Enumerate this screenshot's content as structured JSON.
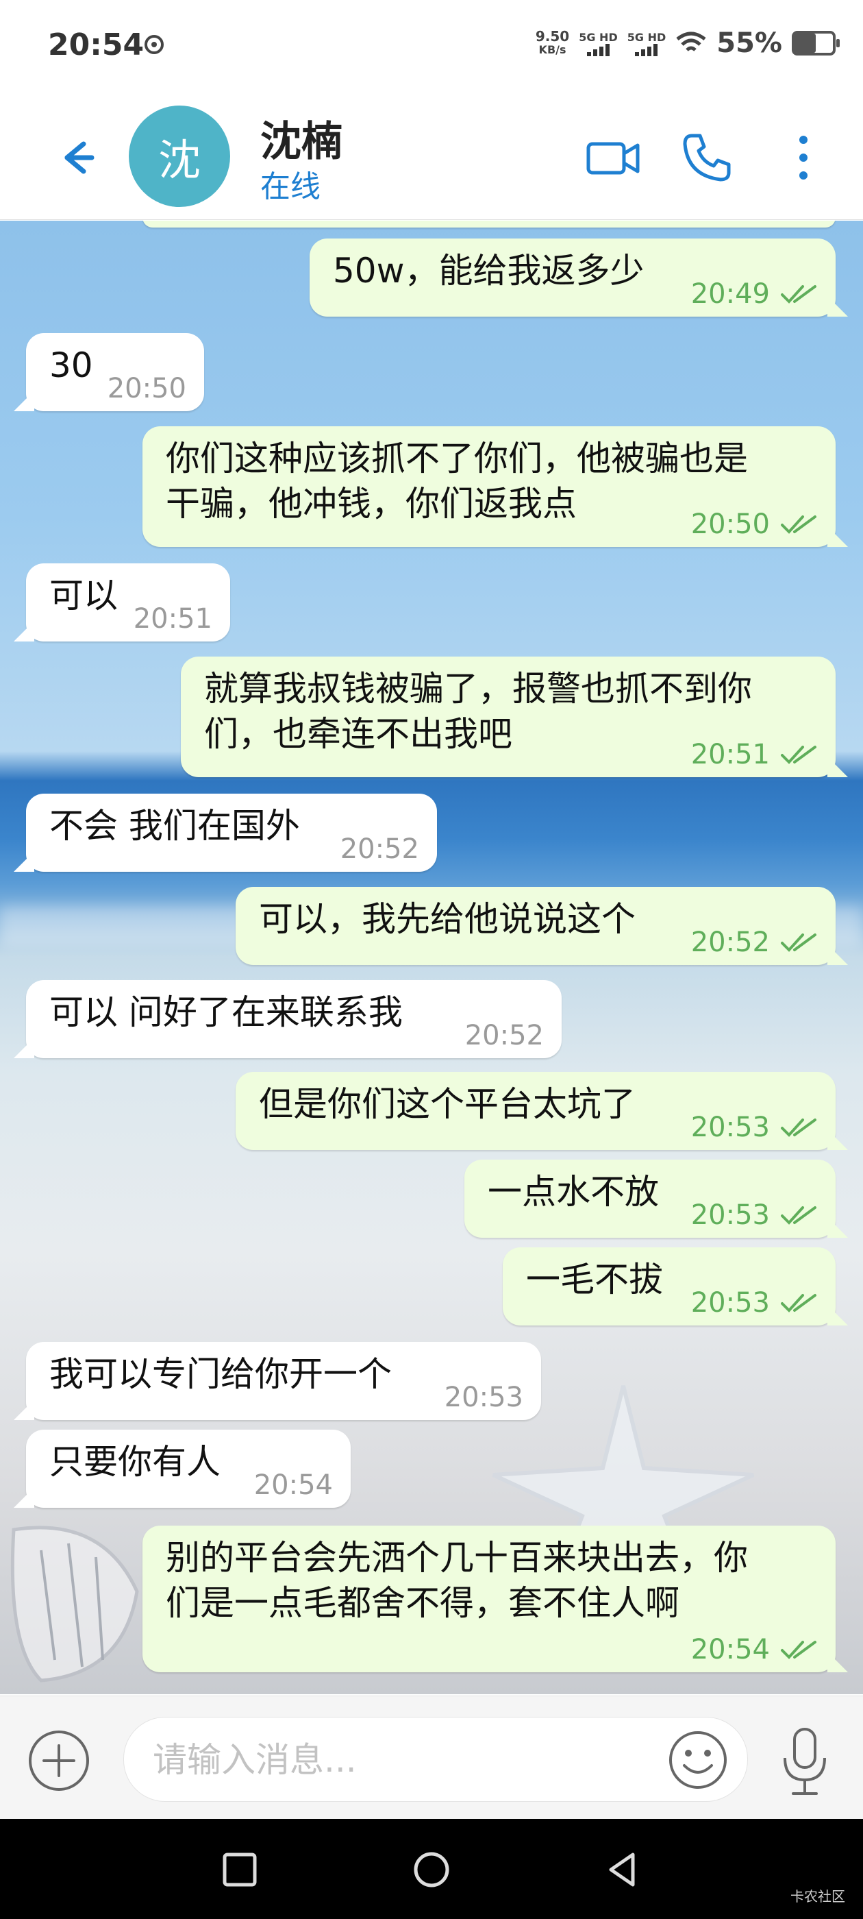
{
  "status_bar": {
    "time": "20:54",
    "speed": "9.50",
    "speed_unit": "KB/s",
    "sim1": "5G HD",
    "sim2": "5G HD",
    "battery": "55%",
    "battery_level": 0.55
  },
  "header": {
    "avatar_letter": "沈",
    "contact_name": "沈楠",
    "status": "在线",
    "icons": [
      "back-arrow-icon",
      "video-call-icon",
      "phone-call-icon",
      "more-vert-icon"
    ]
  },
  "messages": [
    {
      "dir": "out",
      "lines": [
        "50w，能给我返多少"
      ],
      "time": "20:49"
    },
    {
      "dir": "in",
      "lines": [
        "30"
      ],
      "time": "20:50"
    },
    {
      "dir": "out",
      "lines": [
        "你们这种应该抓不了你们，他被骗也是",
        "干骗，他冲钱，你们返我点"
      ],
      "time": "20:50"
    },
    {
      "dir": "in",
      "lines": [
        "可以"
      ],
      "time": "20:51"
    },
    {
      "dir": "out",
      "lines": [
        "就算我叔钱被骗了，报警也抓不到你",
        "们，也牵连不出我吧"
      ],
      "time": "20:51"
    },
    {
      "dir": "in",
      "lines": [
        "不会 我们在国外"
      ],
      "time": "20:52"
    },
    {
      "dir": "out",
      "lines": [
        "可以，我先给他说说这个"
      ],
      "time": "20:52"
    },
    {
      "dir": "in",
      "lines": [
        "可以  问好了在来联系我"
      ],
      "time": "20:52"
    },
    {
      "dir": "out",
      "lines": [
        "但是你们这个平台太坑了"
      ],
      "time": "20:53"
    },
    {
      "dir": "out",
      "lines": [
        "一点水不放"
      ],
      "time": "20:53"
    },
    {
      "dir": "out",
      "lines": [
        "一毛不拔"
      ],
      "time": "20:53"
    },
    {
      "dir": "in",
      "lines": [
        "我可以专门给你开一个"
      ],
      "time": "20:53"
    },
    {
      "dir": "in",
      "lines": [
        "只要你有人"
      ],
      "time": "20:54"
    },
    {
      "dir": "out",
      "lines": [
        "别的平台会先洒个几十百来块出去，你",
        "们是一点毛都舍不得，套不住人啊"
      ],
      "time": "20:54"
    }
  ],
  "input": {
    "placeholder": "请输入消息...",
    "icons": [
      "attach-plus-icon",
      "emoji-icon",
      "microphone-icon"
    ]
  },
  "nav": {
    "icons": [
      "recents-square-icon",
      "home-circle-icon",
      "back-triangle-icon"
    ],
    "watermark": "卡农社区"
  },
  "colors": {
    "accent": "#1e7fd1",
    "avatar_bg": "#4fb4c8",
    "incoming_bubble": "#ffffff",
    "outgoing_bubble": "#effdde",
    "outgoing_time": "#5fae5a"
  }
}
